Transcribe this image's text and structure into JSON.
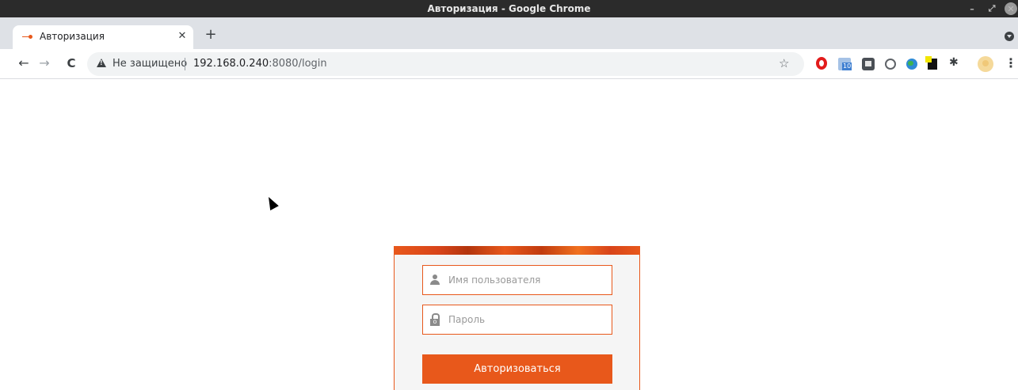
{
  "window": {
    "title": "Авторизация - Google Chrome",
    "controls": {
      "minimize": "–",
      "maximize": "⤢",
      "close": "✕"
    }
  },
  "tabs": [
    {
      "title": "Авторизация",
      "close": "✕",
      "favicon": "key-icon"
    }
  ],
  "newtab_label": "+",
  "toolbar": {
    "back": "←",
    "forward": "→",
    "reload": "C",
    "security_label": "Не защищено",
    "url_host": "192.168.0.240",
    "url_rest": ":8080/login",
    "star": "☆",
    "puzzle": "✱",
    "menu": "⋮",
    "extensions": [
      "opera-icon",
      "mail-icon",
      "box-icon",
      "globe-icon",
      "earth-icon",
      "note-icon",
      "puzzle-icon"
    ]
  },
  "login": {
    "username_placeholder": "Имя пользователя",
    "password_placeholder": "Пароль",
    "submit_label": "Авторизоваться",
    "accent_color": "#e8581b"
  }
}
